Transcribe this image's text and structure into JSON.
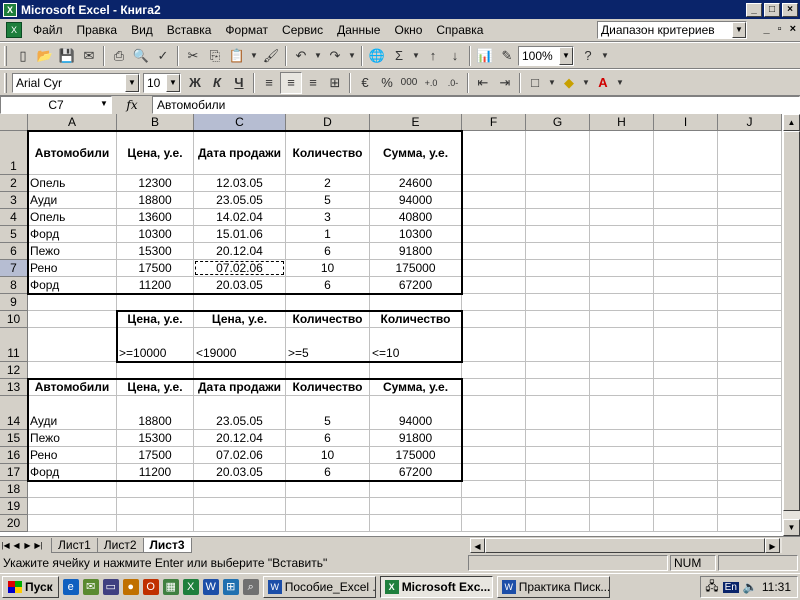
{
  "window": {
    "title": "Microsoft Excel - Книга2",
    "controls": {
      "minimize": "_",
      "maximize": "□",
      "close": "×"
    }
  },
  "menu": {
    "items": [
      "Файл",
      "Правка",
      "Вид",
      "Вставка",
      "Формат",
      "Сервис",
      "Данные",
      "Окно",
      "Справка"
    ],
    "help_box": "Диапазон критериев",
    "doc_controls": {
      "minimize": "_",
      "restore": "▫",
      "close": "×"
    }
  },
  "toolbar": {
    "zoom": "100%",
    "font": "Arial Cyr",
    "font_size": "10",
    "bold": "Ж",
    "italic": "К",
    "underline": "Ч",
    "percent": "%",
    "thousands": "000",
    "sigma": "Σ"
  },
  "formula_bar": {
    "name_box": "C7",
    "fx": "fx",
    "content": "Автомобили"
  },
  "sheet": {
    "columns": [
      "A",
      "B",
      "C",
      "D",
      "E",
      "F",
      "G",
      "H",
      "I",
      "J"
    ],
    "selected_column": "C",
    "selected_row": "7",
    "rows": {
      "1": [
        "Автомобили",
        "Цена, у.е.",
        "Дата продажи",
        "Количество",
        "Сумма, у.е."
      ],
      "2": [
        "Опель",
        "12300",
        "12.03.05",
        "2",
        "24600"
      ],
      "3": [
        "Ауди",
        "18800",
        "23.05.05",
        "5",
        "94000"
      ],
      "4": [
        "Опель",
        "13600",
        "14.02.04",
        "3",
        "40800"
      ],
      "5": [
        "Форд",
        "10300",
        "15.01.06",
        "1",
        "10300"
      ],
      "6": [
        "Пежо",
        "15300",
        "20.12.04",
        "6",
        "91800"
      ],
      "7": [
        "Рено",
        "17500",
        "07.02.06",
        "10",
        "175000"
      ],
      "8": [
        "Форд",
        "11200",
        "20.03.05",
        "6",
        "67200"
      ],
      "10": [
        "",
        "Цена, у.е.",
        "Цена, у.е.",
        "Количество",
        "Количество"
      ],
      "11": [
        "",
        ">=10000",
        "<19000",
        ">=5",
        "<=10"
      ],
      "13": [
        "Автомобили",
        "Цена, у.е.",
        "Дата продажи",
        "Количество",
        "Сумма, у.е."
      ],
      "14": [
        "Ауди",
        "18800",
        "23.05.05",
        "5",
        "94000"
      ],
      "15": [
        "Пежо",
        "15300",
        "20.12.04",
        "6",
        "91800"
      ],
      "16": [
        "Рено",
        "17500",
        "07.02.06",
        "10",
        "175000"
      ],
      "17": [
        "Форд",
        "11200",
        "20.03.05",
        "6",
        "67200"
      ]
    }
  },
  "sheet_tabs": [
    "Лист1",
    "Лист2",
    "Лист3"
  ],
  "active_tab": "Лист3",
  "status": {
    "message": "Укажите ячейку и нажмите Enter или выберите \"Вставить\"",
    "mode": "NUM"
  },
  "taskbar": {
    "start": "Пуск",
    "buttons": [
      "Пособие_Excel ...",
      "Microsoft Exc...",
      "Практика Писк..."
    ],
    "active_button": 1,
    "lang": "En",
    "clock": "11:31"
  }
}
